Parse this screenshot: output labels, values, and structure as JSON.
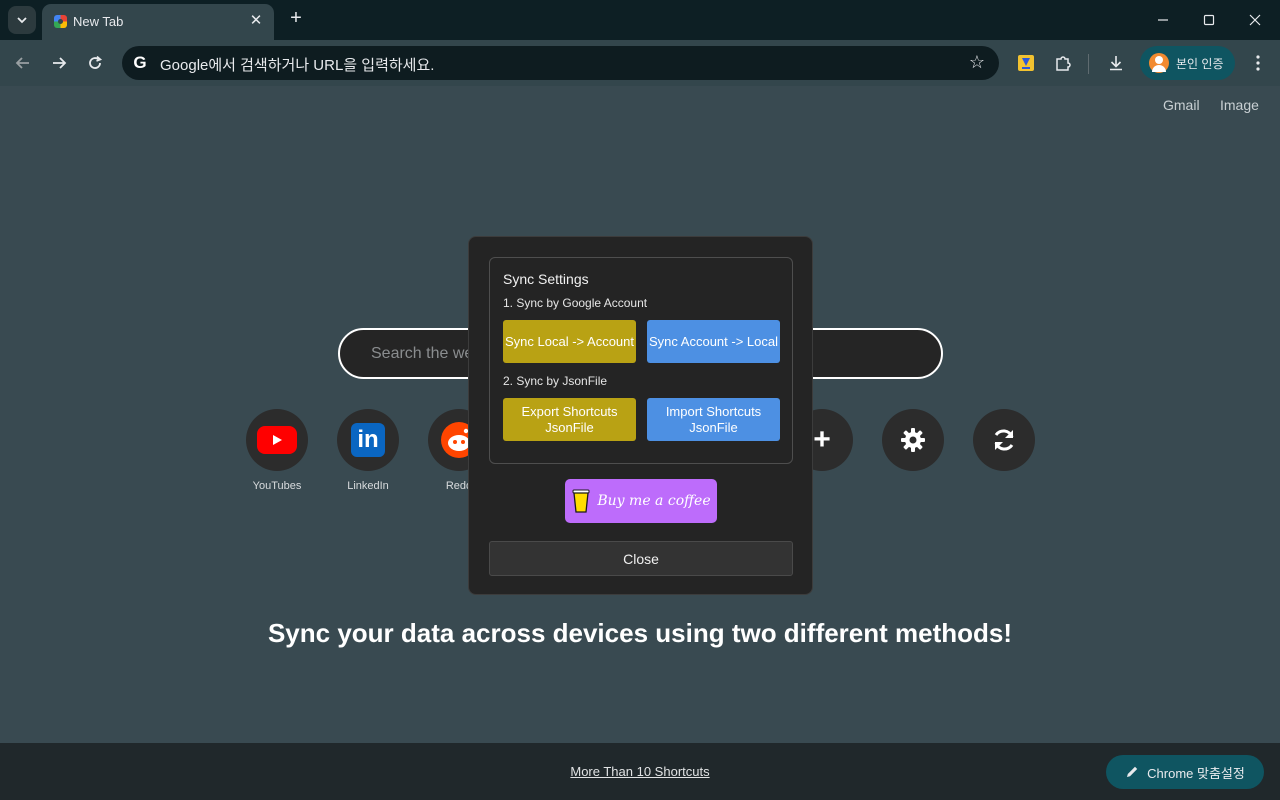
{
  "browser": {
    "tab": {
      "title": "New Tab",
      "close_glyph": "✕"
    },
    "new_tab_glyph": "+",
    "omnibox": {
      "g_letter": "G",
      "placeholder": "Google에서 검색하거나 URL을 입력하세요."
    },
    "profile": {
      "label": "본인 인증"
    },
    "icons": [
      "tab-search-icon",
      "back-icon",
      "forward-icon",
      "reload-icon",
      "star-icon",
      "sync-extension-icon",
      "extensions-icon",
      "download-icon",
      "kebab-menu-icon",
      "minimize-icon",
      "maximize-icon",
      "close-window-icon"
    ]
  },
  "page": {
    "top_links": [
      "Gmail",
      "Image"
    ],
    "search": {
      "placeholder": "Search the we"
    },
    "shortcuts": [
      {
        "label": "YouTubes",
        "icon": "youtube-icon"
      },
      {
        "label": "LinkedIn",
        "icon": "linkedin-icon"
      },
      {
        "label": "Redd",
        "icon": "reddit-icon"
      }
    ],
    "shortcut_actions": {
      "add_glyph": "+",
      "add_icon": "plus-icon",
      "settings_icon": "gear-icon",
      "sync_icon": "sync-icon"
    },
    "caption": "Sync your data across devices using two different methods!",
    "more_link": "More Than 10 Shortcuts",
    "customize": {
      "label": "Chrome 맞춤설정",
      "icon": "pencil-icon"
    }
  },
  "modal": {
    "title": "Sync Settings",
    "section1": "1. Sync by Google Account",
    "section2": "2. Sync by JsonFile",
    "buttons": {
      "local_to_account": "Sync Local -> Account",
      "account_to_local": "Sync Account -> Local",
      "export": "Export Shortcuts JsonFile",
      "import": "Import Shortcuts JsonFile"
    },
    "coffee": "Buy me a coffee",
    "close": "Close"
  },
  "colors": {
    "page_bg": "#394a51",
    "toolbar_bg": "#33464c",
    "yellow_button": "#b9a214",
    "blue_button": "#4d90e3",
    "coffee_button": "#bd6cfb",
    "profile_pill": "#0f5561"
  }
}
